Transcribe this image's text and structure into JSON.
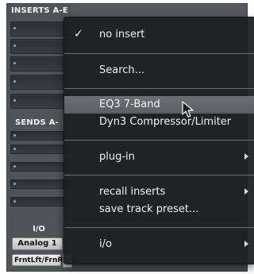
{
  "strip": {
    "inserts_header": "INSERTS A-E",
    "sends_header": "SENDS A-",
    "io_header": "I/O",
    "input_button": "Analog 1",
    "output_button": "FrntLft/FrnR",
    "output_arrow_icon": "dropdown-arrow-icon"
  },
  "menu": {
    "items": [
      {
        "label": "no insert",
        "checked": true,
        "submenu": false
      },
      {
        "label": "Search...",
        "checked": false,
        "submenu": false
      },
      {
        "label": "EQ3 7-Band",
        "checked": false,
        "submenu": false,
        "highlighted": true
      },
      {
        "label": "Dyn3 Compressor/Limiter",
        "checked": false,
        "submenu": false
      },
      {
        "label": "plug-in",
        "checked": false,
        "submenu": true
      },
      {
        "label": "recall inserts",
        "checked": false,
        "submenu": true
      },
      {
        "label": "save track preset...",
        "checked": false,
        "submenu": false
      },
      {
        "label": "i/o",
        "checked": false,
        "submenu": true
      }
    ],
    "check_glyph": "✓"
  },
  "cursor_icon": "arrow-pointer-icon"
}
